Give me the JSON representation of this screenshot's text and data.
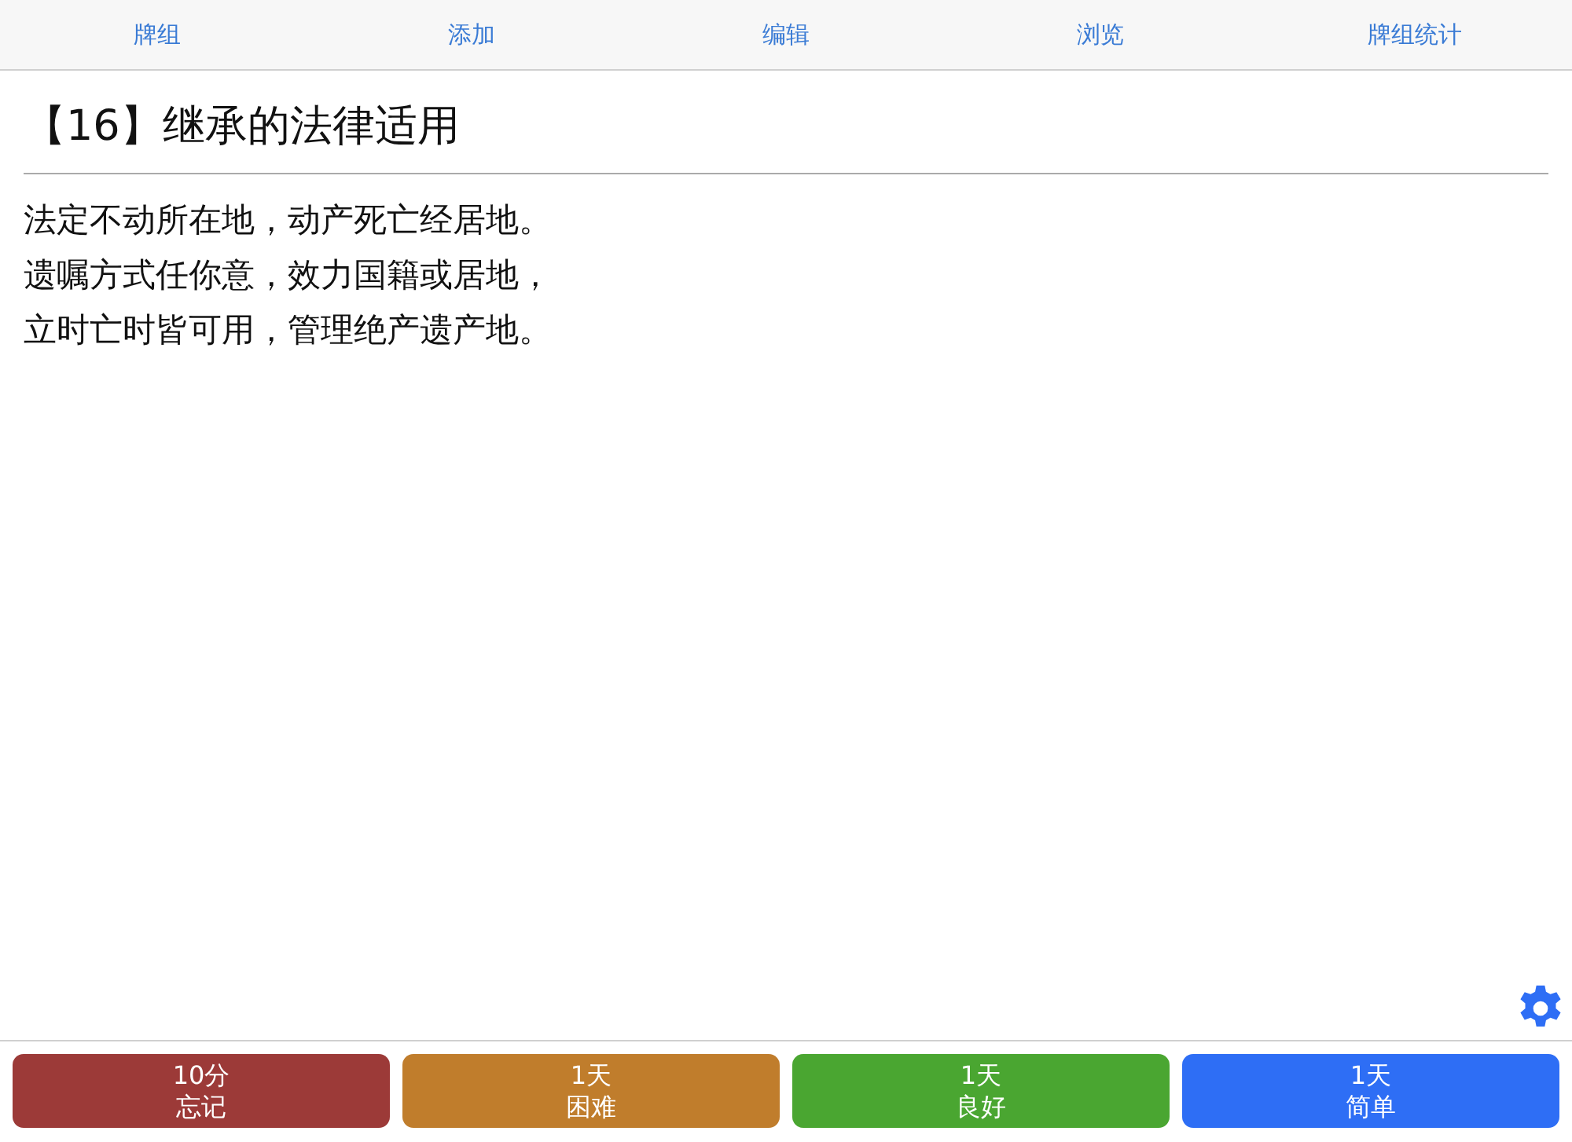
{
  "toolbar": {
    "items": [
      {
        "label": "牌组"
      },
      {
        "label": "添加"
      },
      {
        "label": "编辑"
      },
      {
        "label": "浏览"
      },
      {
        "label": "牌组统计"
      }
    ]
  },
  "card": {
    "title": "【16】继承的法律适用",
    "lines": [
      "法定不动所在地，动产死亡经居地。",
      "遗嘱方式任你意，效力国籍或居地，",
      "立时亡时皆可用，管理绝产遗产地。"
    ]
  },
  "answers": [
    {
      "interval": "10分",
      "label": "忘记",
      "color": "#9c3a38"
    },
    {
      "interval": "1天",
      "label": "困难",
      "color": "#c07d2c"
    },
    {
      "interval": "1天",
      "label": "良好",
      "color": "#4aa631"
    },
    {
      "interval": "1天",
      "label": "简单",
      "color": "#2e6ef5"
    }
  ]
}
